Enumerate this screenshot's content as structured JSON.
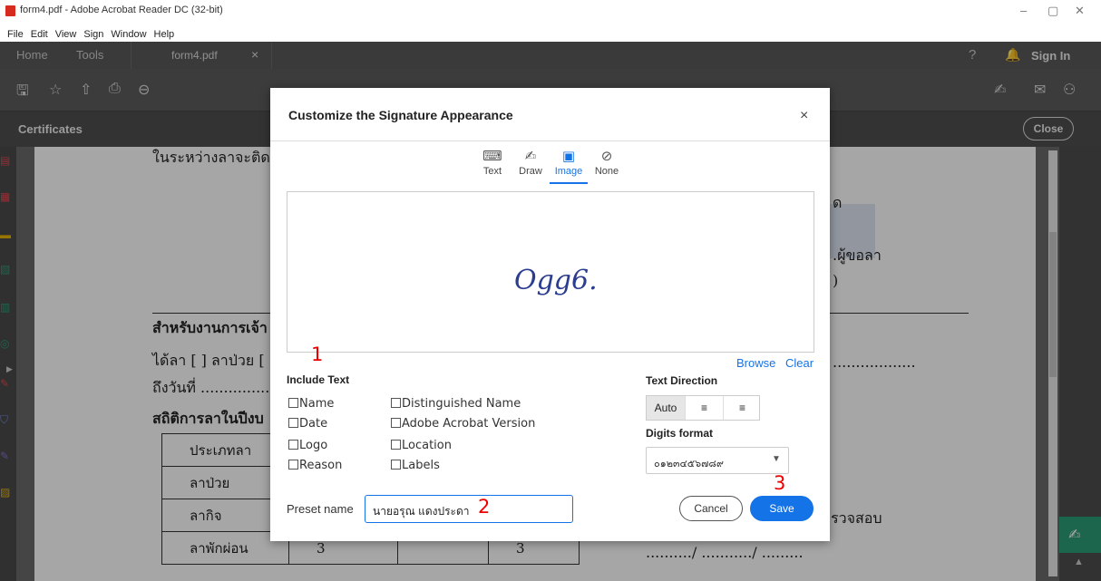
{
  "window": {
    "title": "form4.pdf - Adobe Acrobat Reader DC (32-bit)",
    "controls": [
      "–",
      "▢",
      "✕"
    ]
  },
  "menu": [
    "File",
    "Edit",
    "View",
    "Sign",
    "Window",
    "Help"
  ],
  "tabs": {
    "home": "Home",
    "tools": "Tools",
    "doc": "form4.pdf",
    "doc_close": "×",
    "sign_in": "Sign In"
  },
  "certbar": {
    "label": "Certificates",
    "close": "Close"
  },
  "document": {
    "line1": "ในระหว่างลาจะติด",
    "frag1": "ด",
    "frag2": ".ผู้ขอลา",
    "frag3": ")",
    "sect1": "สำหรับงานการเจ้า",
    "line2": "ได้ลา [ ] ลาป่วย [",
    "line3": "ถึงวันที่ ...............",
    "sect2": "สถิติการลาในปีงบ",
    "dots": "..................",
    "frag4": "รวจสอบ",
    "frag5": "........../ .........../ .........",
    "table": {
      "header": "ประเภทลา",
      "rows": [
        {
          "type": "ลาป่วย",
          "v1": "",
          "v2": ""
        },
        {
          "type": "ลากิจ",
          "v1": "",
          "v2": ""
        },
        {
          "type": "ลาพักผ่อน",
          "v1": "3",
          "v2": "3"
        }
      ]
    }
  },
  "dialog": {
    "title": "Customize the Signature Appearance",
    "close": "×",
    "modes": [
      {
        "label": "Text",
        "icon": "keyboard-icon"
      },
      {
        "label": "Draw",
        "icon": "pen-icon"
      },
      {
        "label": "Image",
        "icon": "image-icon"
      },
      {
        "label": "None",
        "icon": "none-icon"
      }
    ],
    "active_mode": "Image",
    "signature_text": "Ogg6.",
    "browse": "Browse",
    "clear": "Clear",
    "include_text": "Include Text",
    "options_left": [
      "Name",
      "Date",
      "Logo",
      "Reason"
    ],
    "options_right": [
      "Distinguished Name",
      "Adobe Acrobat Version",
      "Location",
      "Labels"
    ],
    "text_direction": "Text Direction",
    "dir_auto": "Auto",
    "digits_format": "Digits format",
    "digits_value": "๐๑๒๓๔๕๖๗๘๙",
    "preset_label": "Preset name",
    "preset_value": "นายอรุณ แดงประดา",
    "cancel": "Cancel",
    "save": "Save"
  },
  "annotations": [
    "1",
    "2",
    "3"
  ],
  "accent": "#1473e6"
}
